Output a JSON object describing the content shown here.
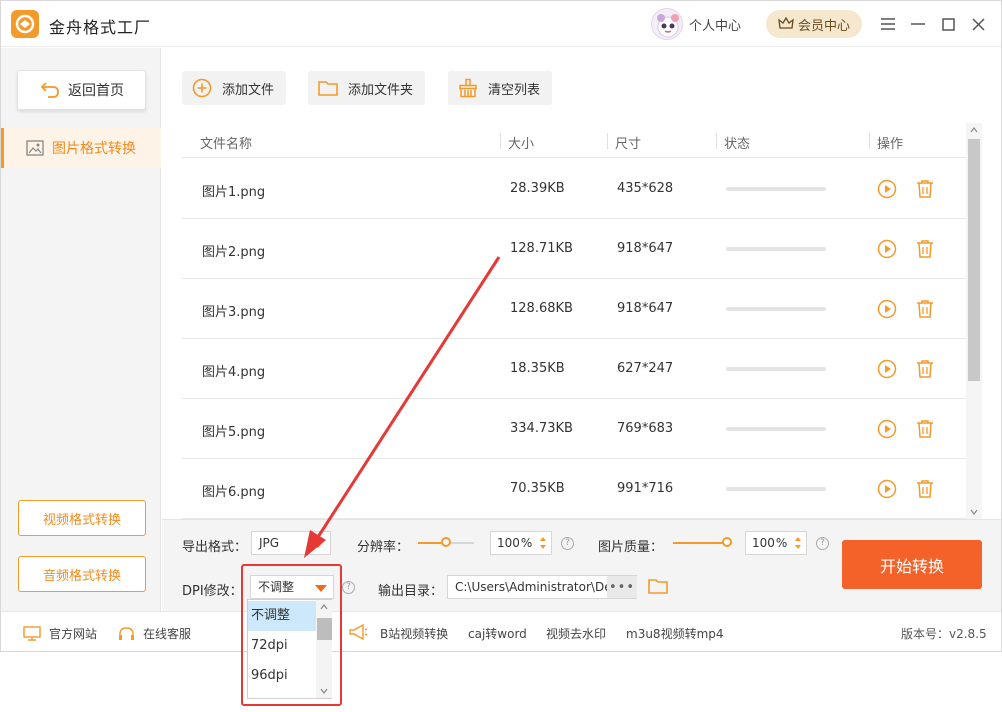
{
  "app": {
    "title": "金舟格式工厂"
  },
  "header": {
    "user_center": "个人中心",
    "vip_center": "会员中心"
  },
  "sidebar": {
    "back": "返回首页",
    "active_item": "图片格式转换",
    "video_convert": "视频格式转换",
    "audio_convert": "音频格式转换"
  },
  "toolbar": {
    "add_file": "添加文件",
    "add_folder": "添加文件夹",
    "clear_list": "清空列表"
  },
  "table": {
    "headers": [
      "文件名称",
      "大小",
      "尺寸",
      "状态",
      "操作"
    ],
    "rows": [
      {
        "name": "图片1.png",
        "size": "28.39KB",
        "dims": "435*628",
        "progress": 0
      },
      {
        "name": "图片2.png",
        "size": "128.71KB",
        "dims": "918*647",
        "progress": 0
      },
      {
        "name": "图片3.png",
        "size": "128.68KB",
        "dims": "918*647",
        "progress": 0
      },
      {
        "name": "图片4.png",
        "size": "18.35KB",
        "dims": "627*247",
        "progress": 0
      },
      {
        "name": "图片5.png",
        "size": "334.73KB",
        "dims": "769*683",
        "progress": 0
      },
      {
        "name": "图片6.png",
        "size": "70.35KB",
        "dims": "991*716",
        "progress": 0
      }
    ]
  },
  "settings": {
    "export_format_label": "导出格式：",
    "export_format_value": "JPG",
    "resolution_label": "分辨率：",
    "resolution_value": "100",
    "quality_label": "图片质量：",
    "quality_value": "100",
    "percent": "%",
    "dpi_label": "DPI修改：",
    "dpi_value": "不调整",
    "output_label": "输出目录：",
    "output_path": "C:\\Users\\Administrator\\De",
    "dots": "•••",
    "help": "?",
    "start": "开始转换"
  },
  "dpi_options": [
    "不调整",
    "72dpi",
    "96dpi"
  ],
  "footer": {
    "website": "官方网站",
    "service": "在线客服",
    "links": [
      "B站视频转换",
      "caj转word",
      "视频去水印",
      "m3u8视频转mp4"
    ],
    "version": "版本号：v2.8.5"
  },
  "colors": {
    "accent": "#f39a2b",
    "start_button": "#f4622a",
    "highlight_box": "#e53935"
  }
}
